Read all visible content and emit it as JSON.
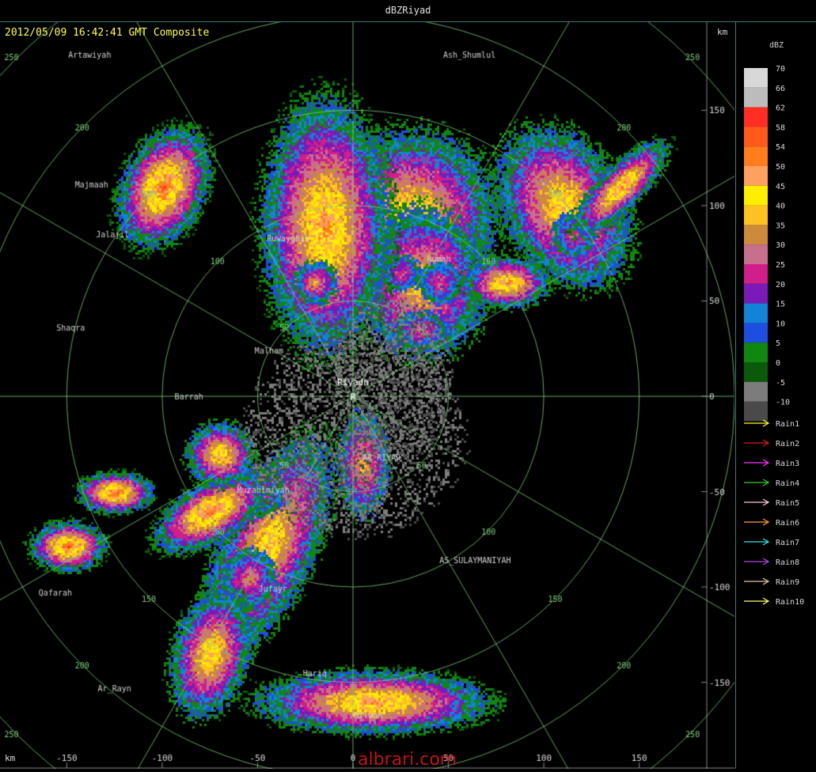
{
  "title": "dBZRiyad",
  "timestamp": "2012/05/09 16:42:41 GMT Composite",
  "units_top": "km",
  "units_bottom": "km",
  "watermark": "albrari.com",
  "legend": {
    "title": "dBZ",
    "bins": [
      {
        "label": "70",
        "color": "#d8d8d8"
      },
      {
        "label": "66",
        "color": "#bcbcbc"
      },
      {
        "label": "62",
        "color": "#ff2e24"
      },
      {
        "label": "58",
        "color": "#ff5a1a"
      },
      {
        "label": "54",
        "color": "#ff7d1a"
      },
      {
        "label": "50",
        "color": "#ffa060"
      },
      {
        "label": "45",
        "color": "#ffee00"
      },
      {
        "label": "40",
        "color": "#ffc021"
      },
      {
        "label": "35",
        "color": "#cc8a3a"
      },
      {
        "label": "30",
        "color": "#c86f8e"
      },
      {
        "label": "25",
        "color": "#d01e8a"
      },
      {
        "label": "20",
        "color": "#7a1ab8"
      },
      {
        "label": "15",
        "color": "#1283d6"
      },
      {
        "label": "10",
        "color": "#1e4ee0"
      },
      {
        "label": "5",
        "color": "#118611"
      },
      {
        "label": "0",
        "color": "#0a5a0a"
      },
      {
        "label": "-5",
        "color": "#7c7c7c"
      },
      {
        "label": "-10",
        "color": "#4a4a4a"
      }
    ],
    "tracks": [
      {
        "label": "Rain1",
        "color": "#ffff33"
      },
      {
        "label": "Rain2",
        "color": "#e01818"
      },
      {
        "label": "Rain3",
        "color": "#ff33ff"
      },
      {
        "label": "Rain4",
        "color": "#33cc33"
      },
      {
        "label": "Rain5",
        "color": "#ffc8d8"
      },
      {
        "label": "Rain6",
        "color": "#ff9b50"
      },
      {
        "label": "Rain7",
        "color": "#33e6e6"
      },
      {
        "label": "Rain8",
        "color": "#b04ae0"
      },
      {
        "label": "Rain9",
        "color": "#e6c8a0"
      },
      {
        "label": "Rain10",
        "color": "#ffff66"
      }
    ]
  },
  "map_data": {
    "range_km": 185,
    "rings_km": [
      50,
      100,
      150,
      200,
      250
    ],
    "spokes_deg": [
      0,
      30,
      60,
      90,
      120,
      150,
      180,
      210,
      240,
      270,
      300,
      330
    ],
    "grid_color": "#7ed07e",
    "x_ticks": [
      -150,
      -100,
      -50,
      0,
      50,
      100,
      150
    ],
    "y_ticks": [
      150,
      100,
      50,
      0,
      -50,
      -100,
      -150
    ],
    "ring_labels": [
      {
        "text": "250",
        "x": -179,
        "y": 178
      },
      {
        "text": "250",
        "x": 178,
        "y": 178
      },
      {
        "text": "250",
        "x": -179,
        "y": -177
      },
      {
        "text": "250",
        "x": 178,
        "y": -177
      },
      {
        "text": "200",
        "x": -142,
        "y": 141
      },
      {
        "text": "200",
        "x": 142,
        "y": 141
      },
      {
        "text": "200",
        "x": -142,
        "y": -141
      },
      {
        "text": "200",
        "x": 142,
        "y": -141
      },
      {
        "text": "150",
        "x": -107,
        "y": 106
      },
      {
        "text": "150",
        "x": 106,
        "y": 106
      },
      {
        "text": "150",
        "x": -107,
        "y": -106
      },
      {
        "text": "150",
        "x": 106,
        "y": -106
      },
      {
        "text": "100",
        "x": -71,
        "y": 71
      },
      {
        "text": "100",
        "x": 71,
        "y": 71
      },
      {
        "text": "100",
        "x": -71,
        "y": -71
      },
      {
        "text": "100",
        "x": 71,
        "y": -71
      },
      {
        "text": "50",
        "x": -36,
        "y": 36
      },
      {
        "text": "50",
        "x": 36,
        "y": 36
      },
      {
        "text": "50",
        "x": -36,
        "y": -36
      },
      {
        "text": "50",
        "x": 36,
        "y": -36
      }
    ],
    "station": {
      "name": "Riyadh",
      "marker": "R",
      "x": 0,
      "y": 0
    },
    "places": [
      {
        "name": "Artawiyah",
        "x": -138,
        "y": 179
      },
      {
        "name": "Ash_Shumlul",
        "x": 61,
        "y": 179
      },
      {
        "name": "Majmaah",
        "x": -137,
        "y": 111
      },
      {
        "name": "Jalajil",
        "x": -126,
        "y": 85
      },
      {
        "name": "Ruwayghib",
        "x": -34,
        "y": 83
      },
      {
        "name": "Rumah",
        "x": 45,
        "y": 72
      },
      {
        "name": "Shaqra",
        "x": -148,
        "y": 36
      },
      {
        "name": "Malham",
        "x": -44,
        "y": 24
      },
      {
        "name": "Barrah",
        "x": -86,
        "y": 0
      },
      {
        "name": "AR_RIYAD",
        "x": 15,
        "y": -32
      },
      {
        "name": "Muzahimiyah",
        "x": -47,
        "y": -49
      },
      {
        "name": "AS_SULAYMANIYAH",
        "x": 64,
        "y": -86
      },
      {
        "name": "Qafarah",
        "x": -156,
        "y": -103
      },
      {
        "name": "Jufayr",
        "x": -42,
        "y": -101
      },
      {
        "name": "Hariq",
        "x": -20,
        "y": -145
      },
      {
        "name": "Ar_Rayn",
        "x": -125,
        "y": -153
      },
      {
        "name": "Hilwah",
        "x": 8,
        "y": -167
      }
    ],
    "echoes": [
      {
        "x": -45,
        "y": -78,
        "dx": 22,
        "dy": 55,
        "rot": 25,
        "peak": 12
      },
      {
        "x": -50,
        "y": -50,
        "dx": 12,
        "dy": 12,
        "rot": 0,
        "peak": 8
      },
      {
        "x": -55,
        "y": -95,
        "dx": 12,
        "dy": 14,
        "rot": 0,
        "peak": 9
      },
      {
        "x": -75,
        "y": -60,
        "dx": 30,
        "dy": 14,
        "rot": -30,
        "peak": 14
      },
      {
        "x": -75,
        "y": -135,
        "dx": 18,
        "dy": 30,
        "rot": 15,
        "peak": 12
      },
      {
        "x": -70,
        "y": -30,
        "dx": 16,
        "dy": 15,
        "rot": 0,
        "peak": 12
      },
      {
        "x": -125,
        "y": -50,
        "dx": 18,
        "dy": 10,
        "rot": 0,
        "peak": 14
      },
      {
        "x": -150,
        "y": -78,
        "dx": 18,
        "dy": 12,
        "rot": 0,
        "peak": 14
      },
      {
        "x": 5,
        "y": -35,
        "dx": 12,
        "dy": 25,
        "rot": 0,
        "peak": 10
      },
      {
        "x": 10,
        "y": -160,
        "dx": 55,
        "dy": 15,
        "rot": 0,
        "peak": 13
      },
      {
        "x": 30,
        "y": 95,
        "dx": 40,
        "dy": 40,
        "rot": 0,
        "peak": 12
      },
      {
        "x": 35,
        "y": 60,
        "dx": 30,
        "dy": 35,
        "rot": 0,
        "peak": 11
      },
      {
        "x": 45,
        "y": 60,
        "dx": 10,
        "dy": 10,
        "rot": 0,
        "peak": 8
      },
      {
        "x": 25,
        "y": 65,
        "dx": 9,
        "dy": 8,
        "rot": 0,
        "peak": 8
      },
      {
        "x": 35,
        "y": 35,
        "dx": 12,
        "dy": 9,
        "rot": 0,
        "peak": 8
      },
      {
        "x": -15,
        "y": 90,
        "dx": 30,
        "dy": 60,
        "rot": 0,
        "peak": 13
      },
      {
        "x": -20,
        "y": 60,
        "dx": 10,
        "dy": 10,
        "rot": 0,
        "peak": 10
      },
      {
        "x": 110,
        "y": 100,
        "dx": 28,
        "dy": 40,
        "rot": -30,
        "peak": 12
      },
      {
        "x": 115,
        "y": 85,
        "dx": 10,
        "dy": 10,
        "rot": 0,
        "peak": 8
      },
      {
        "x": 140,
        "y": 110,
        "dx": 30,
        "dy": 10,
        "rot": -45,
        "peak": 13
      },
      {
        "x": -100,
        "y": 110,
        "dx": 20,
        "dy": 30,
        "rot": 25,
        "peak": 14
      },
      {
        "x": 80,
        "y": 60,
        "dx": 20,
        "dy": 12,
        "rot": 0,
        "peak": 13
      },
      {
        "x": 0,
        "y": -20,
        "dx": 55,
        "dy": 50,
        "rot": 0,
        "peak": 16
      },
      {
        "x": 20,
        "y": 10,
        "dx": 30,
        "dy": 40,
        "rot": 0,
        "peak": 15
      }
    ]
  }
}
